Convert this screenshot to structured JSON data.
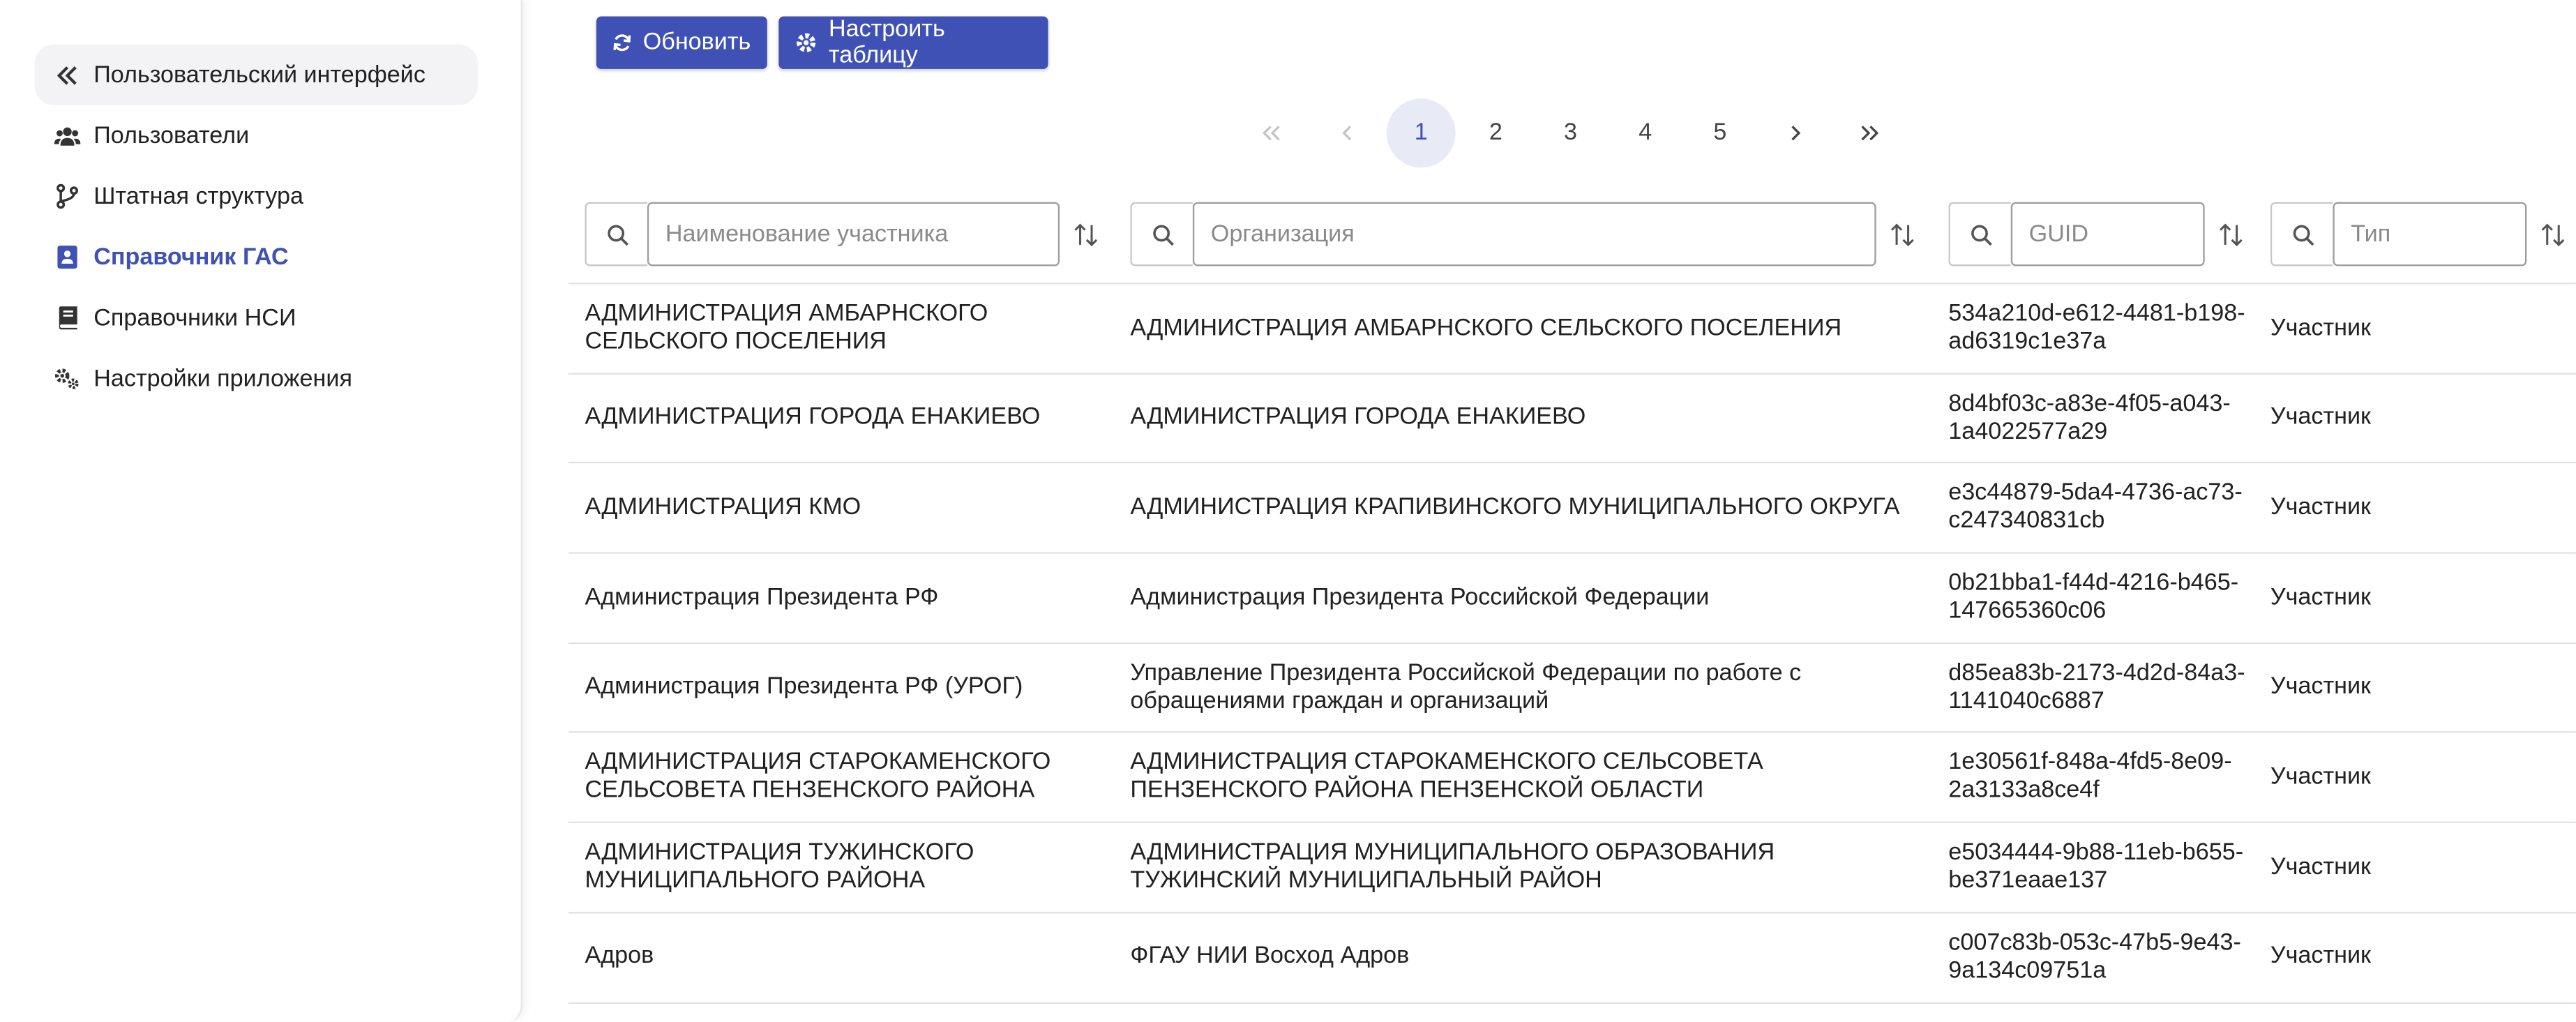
{
  "sidebar": {
    "items": [
      {
        "label": "Пользовательский интерфейс",
        "icon": "double-chevron-left-icon"
      },
      {
        "label": "Пользователи",
        "icon": "users-icon"
      },
      {
        "label": "Штатная структура",
        "icon": "branch-icon"
      },
      {
        "label": "Справочник ГАС",
        "icon": "contact-book-icon",
        "active": true
      },
      {
        "label": "Справочники НСИ",
        "icon": "book-icon"
      },
      {
        "label": "Настройки приложения",
        "icon": "gears-icon"
      }
    ]
  },
  "toolbar": {
    "refresh_label": "Обновить",
    "configure_label": "Настроить таблицу"
  },
  "pagination": {
    "pages": [
      "1",
      "2",
      "3",
      "4",
      "5"
    ],
    "current": "1"
  },
  "filters": {
    "name_placeholder": "Наименование участника",
    "org_placeholder": "Организация",
    "guid_placeholder": "GUID",
    "type_placeholder": "Тип"
  },
  "table": {
    "rows": [
      {
        "name": "АДМИНИСТРАЦИЯ АМБАРНСКОГО СЕЛЬСКОГО ПОСЕЛЕНИЯ",
        "org": "АДМИНИСТРАЦИЯ АМБАРНСКОГО СЕЛЬСКОГО ПОСЕЛЕНИЯ",
        "guid": "534a210d-e612-4481-b198-ad6319c1e37a",
        "type": "Участник"
      },
      {
        "name": "АДМИНИСТРАЦИЯ ГОРОДА ЕНАКИЕВО",
        "org": "АДМИНИСТРАЦИЯ ГОРОДА ЕНАКИЕВО",
        "guid": "8d4bf03c-a83e-4f05-a043-1a4022577a29",
        "type": "Участник"
      },
      {
        "name": "АДМИНИСТРАЦИЯ КМО",
        "org": "АДМИНИСТРАЦИЯ КРАПИВИНСКОГО МУНИЦИПАЛЬНОГО ОКРУГА",
        "guid": "e3c44879-5da4-4736-ac73-c247340831cb",
        "type": "Участник"
      },
      {
        "name": "Администрация Президента РФ",
        "org": "Администрация Президента Российской Федерации",
        "guid": "0b21bba1-f44d-4216-b465-147665360c06",
        "type": "Участник"
      },
      {
        "name": "Администрация Президента РФ (УРОГ)",
        "org": "Управление Президента Российской Федерации по работе с обращениями граждан и организаций",
        "guid": "d85ea83b-2173-4d2d-84a3-1141040c6887",
        "type": "Участник"
      },
      {
        "name": "АДМИНИСТРАЦИЯ СТАРОКАМЕНСКОГО СЕЛЬСОВЕТА ПЕНЗЕНСКОГО РАЙОНА",
        "org": "АДМИНИСТРАЦИЯ СТАРОКАМЕНСКОГО СЕЛЬСОВЕТА ПЕНЗЕНСКОГО РАЙОНА ПЕНЗЕНСКОЙ ОБЛАСТИ",
        "guid": "1e30561f-848a-4fd5-8e09-2a3133a8ce4f",
        "type": "Участник"
      },
      {
        "name": "АДМИНИСТРАЦИЯ ТУЖИНСКОГО МУНИЦИПАЛЬНОГО РАЙОНА",
        "org": "АДМИНИСТРАЦИЯ МУНИЦИПАЛЬНОГО ОБРАЗОВАНИЯ ТУЖИНСКИЙ МУНИЦИПАЛЬНЫЙ РАЙОН",
        "guid": "e5034444-9b88-11eb-b655-be371eaae137",
        "type": "Участник"
      },
      {
        "name": "Адров",
        "org": "ФГАУ НИИ Восход Адров",
        "guid": "c007c83b-053c-47b5-9e43-9a134c09751a",
        "type": "Участник"
      }
    ]
  },
  "colors": {
    "accent": "#3f51b5",
    "page_active_bg": "#e8eaf6"
  }
}
